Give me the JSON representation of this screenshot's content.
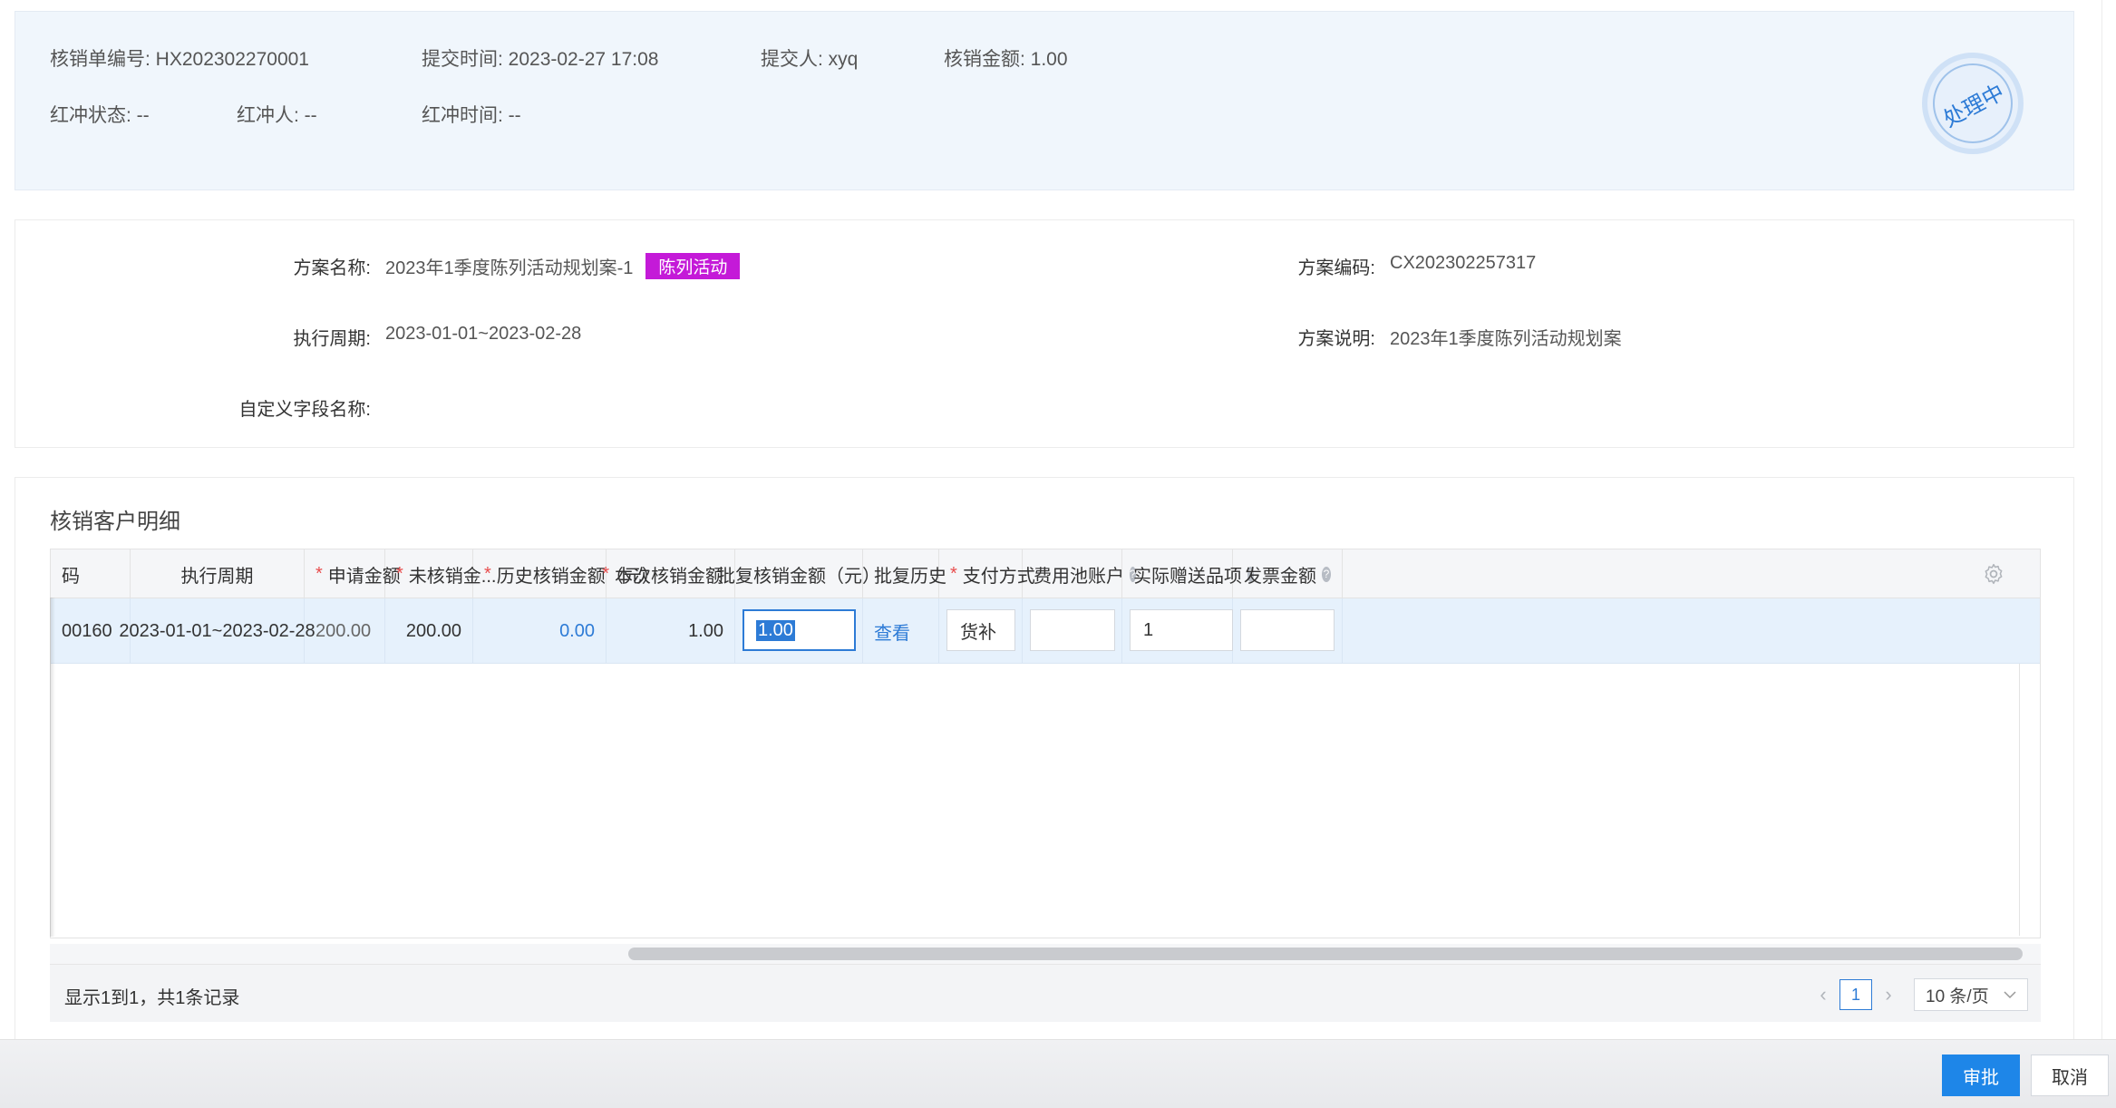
{
  "summary": {
    "order_no": "核销单编号: HX202302270001",
    "submit_time": "提交时间: 2023-02-27 17:08",
    "submitter": "提交人: xyq",
    "amount": "核销金额: 1.00",
    "red_status": "红冲状态: --",
    "red_person": "红冲人: --",
    "red_time": "红冲时间: --",
    "stamp": "处理中"
  },
  "plan": {
    "name_label": "方案名称:",
    "name_value": "2023年1季度陈列活动规划案-1",
    "tag": "陈列活动",
    "code_label": "方案编码:",
    "code_value": "CX202302257317",
    "period_label": "执行周期:",
    "period_value": "2023-01-01~2023-02-28",
    "desc_label": "方案说明:",
    "desc_value": "2023年1季度陈列活动规划案",
    "custom_label": "自定义字段名称:"
  },
  "detail": {
    "title": "核销客户明细",
    "headers": {
      "code": "码",
      "period": "执行周期",
      "apply": "申请金额",
      "unsettled": "未核销金...",
      "history": "历史核销金额（元）",
      "current": "本次核销金额",
      "approved": "批复核销金额（元）",
      "approve_history": "批复历史",
      "payment": "支付方式",
      "pool": "费用池账户",
      "gift": "实际赠送品项",
      "invoice": "发票金额"
    },
    "row": {
      "code": "00160",
      "period": "2023-01-01~2023-02-28",
      "apply": "200.00",
      "unsettled": "200.00",
      "history": "0.00",
      "current": "1.00",
      "approved": "1.00",
      "approve_history_link": "查看",
      "payment": "货补",
      "pool": "",
      "gift": "1",
      "invoice": ""
    },
    "footer": {
      "summary": "显示1到1，共1条记录",
      "page": "1",
      "page_size": "10 条/页"
    }
  },
  "actions": {
    "approve": "审批",
    "cancel": "取消"
  },
  "colors": {
    "accent": "#1e86e8",
    "tag": "#c41ad8",
    "required": "#e84c4c"
  }
}
